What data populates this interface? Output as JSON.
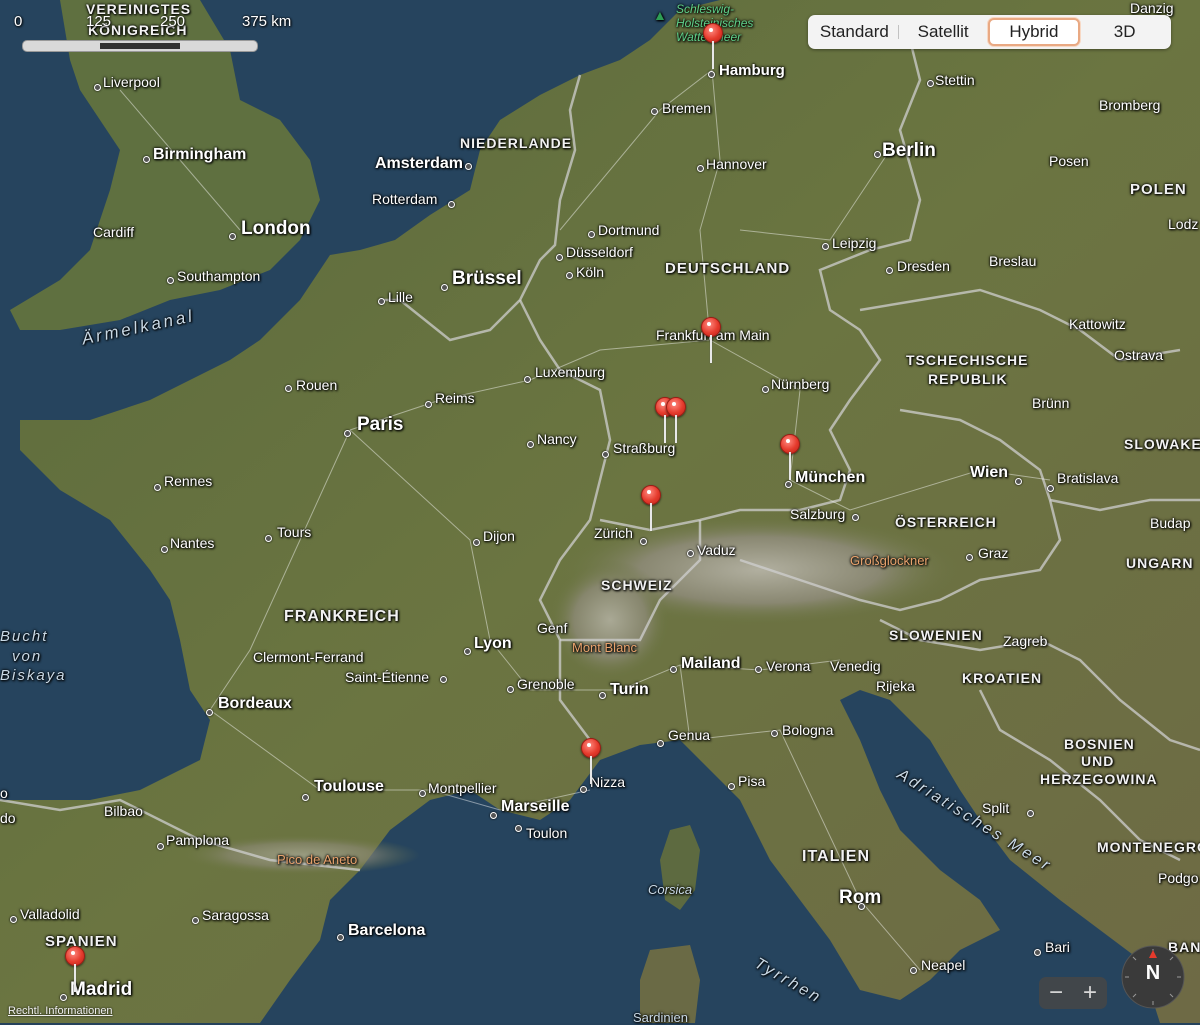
{
  "map_type_control": {
    "options": [
      "Standard",
      "Satellit",
      "Hybrid",
      "3D"
    ],
    "selected": "Hybrid"
  },
  "scale": {
    "ticks": [
      "0",
      "125",
      "250",
      "375 km"
    ]
  },
  "labels": {
    "vereinigtes": "VEREINIGTES",
    "koenigreich": "KÖNIGREICH",
    "liverpool": "Liverpool",
    "birmingham": "Birmingham",
    "cardiff": "Cardiff",
    "london": "London",
    "southampton": "Southampton",
    "aermelkanal": "Ärmelkanal",
    "amsterdam": "Amsterdam",
    "rotterdam": "Rotterdam",
    "niederlande": "NIEDERLANDE",
    "bruessel": "Brüssel",
    "lille": "Lille",
    "hamburg": "Hamburg",
    "bremen": "Bremen",
    "hannover": "Hannover",
    "berlin": "Berlin",
    "stettin": "Stettin",
    "bromberg": "Bromberg",
    "posen": "Posen",
    "polen": "POLEN",
    "lodz": "Lodz",
    "dortmund": "Dortmund",
    "duesseldorf": "Düsseldorf",
    "koeln": "Köln",
    "deutschland": "DEUTSCHLAND",
    "leipzig": "Leipzig",
    "dresden": "Dresden",
    "breslau": "Breslau",
    "kattowitz": "Kattowitz",
    "ostrava": "Ostrava",
    "frankfurt": "Frankfurt am Main",
    "tschechische": "TSCHECHISCHE",
    "republik": "REPUBLIK",
    "luxemburg": "Luxemburg",
    "nuernberg": "Nürnberg",
    "bruenn": "Brünn",
    "rouen": "Rouen",
    "reims": "Reims",
    "paris": "Paris",
    "nancy": "Nancy",
    "strassburg": "Straßburg",
    "muenchen": "München",
    "wien": "Wien",
    "bratislava": "Bratislava",
    "slowakei": "SLOWAKEI",
    "budapest": "Budap",
    "rennes": "Rennes",
    "tours": "Tours",
    "nantes": "Nantes",
    "dijon": "Dijon",
    "zuerich": "Zürich",
    "vaduz": "Vaduz",
    "salzburg": "Salzburg",
    "oesterreich": "ÖSTERREICH",
    "grossglockner": "Großglockner",
    "graz": "Graz",
    "ungarn": "UNGARN",
    "schweiz": "SCHWEIZ",
    "frankreich": "FRANKREICH",
    "bucht": "Bucht",
    "von": "von",
    "biskaya": "Biskaya",
    "lyon": "Lyon",
    "genf": "Genf",
    "mont_blanc": "Mont Blanc",
    "clermont": "Clermont-Ferrand",
    "saint_etienne": "Saint-Étienne",
    "grenoble": "Grenoble",
    "turin": "Turin",
    "mailand": "Mailand",
    "verona": "Verona",
    "venedig": "Venedig",
    "slowenien": "SLOWENIEN",
    "zagreb": "Zagreb",
    "rijeka": "Rijeka",
    "kroatien": "KROATIEN",
    "bordeaux": "Bordeaux",
    "genua": "Genua",
    "bologna": "Bologna",
    "bosnien": "BOSNIEN",
    "und": "UND",
    "herzegowina": "HERZEGOWINA",
    "nizza": "Nizza",
    "pisa": "Pisa",
    "adriatisches": "Adriatisches Meer",
    "toulouse": "Toulouse",
    "montpellier": "Montpellier",
    "marseille": "Marseille",
    "toulon": "Toulon",
    "bilbao": "Bilbao",
    "pamplona": "Pamplona",
    "pico_de_aneto": "Pico de Aneto",
    "split": "Split",
    "montenegro": "MONTENEGRO",
    "italien": "ITALIEN",
    "corsica": "Corsica",
    "rom": "Rom",
    "podgorica": "Podgo",
    "valladolid": "Valladolid",
    "saragossa": "Saragossa",
    "spanien": "SPANIEN",
    "barcelona": "Barcelona",
    "bari": "Bari",
    "neapel": "Neapel",
    "madrid": "Madrid",
    "tyrrhenisches": "Tyrrhen",
    "sardinien": "Sardinien",
    "danzig": "Danzig",
    "schleswig1": "Schleswig-",
    "schleswig2": "Holsteinisches",
    "wattenmeer": "Wattenmeer",
    "left_edge_bao": "do",
    "left_edge_o": "o",
    "right_edge_ban": "BAN"
  },
  "zoom": {
    "minus": "−",
    "plus": "+"
  },
  "compass": {
    "label": "N"
  },
  "legal": "Rechtl. Informationen",
  "pins": [
    "hamburg",
    "frankfurt",
    "strassburg-1",
    "strassburg-2",
    "muenchen",
    "konstanz",
    "nizza",
    "madrid"
  ],
  "colors": {
    "pin": "#e53a2c",
    "selected_border": "#e9a983",
    "water": "#25425c"
  }
}
